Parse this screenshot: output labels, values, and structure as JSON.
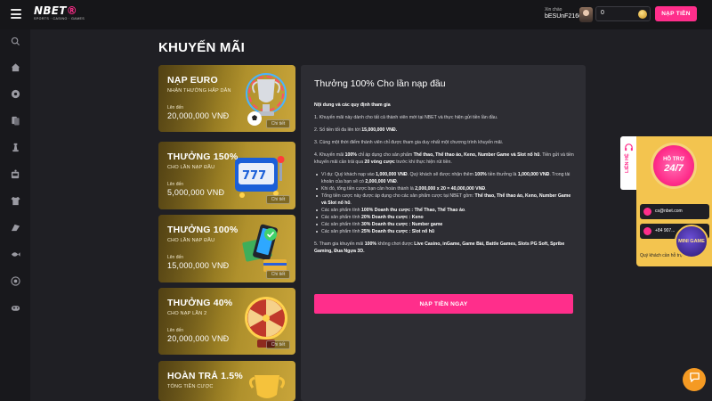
{
  "header": {
    "logo": "NBET",
    "logo_tagline": "SPORTS · CASINO · GAMES",
    "greeting": "Xin chào",
    "username": "bESUnF2166",
    "balance": "0",
    "deposit_label": "NẠP TIỀN",
    "colors": {
      "accent": "#ff2e8b",
      "bg": "#161619"
    }
  },
  "sidebar": {
    "icons": [
      "search-icon",
      "home-icon",
      "sports-ball-icon",
      "cards-icon",
      "chess-icon",
      "slot-machine-icon",
      "shirt-icon",
      "tent-icon",
      "fish-icon",
      "lottery-icon",
      "gamepad-icon"
    ]
  },
  "page": {
    "title": "KHUYẾN MÃI"
  },
  "promos": [
    {
      "title": "NẠP EURO",
      "subtitle": "NHẬN THƯỞNG HẤP DẪN",
      "label": "Lên đến",
      "amount": "20,000,000 VNĐ",
      "detail": "Chi tiết"
    },
    {
      "title": "THƯỞNG 150%",
      "subtitle": "CHO LẦN NẠP ĐẦU",
      "label": "Lên đến",
      "amount": "5,000,000 VNĐ",
      "detail": "Chi tiết"
    },
    {
      "title": "THƯỞNG 100%",
      "subtitle": "CHO LẦN NẠP ĐẦU",
      "label": "Lên đến",
      "amount": "15,000,000 VNĐ",
      "detail": "Chi tiết"
    },
    {
      "title": "THƯỞNG 40%",
      "subtitle": "CHO NẠP LẦN 2",
      "label": "Lên đến",
      "amount": "20,000,000 VNĐ",
      "detail": "Chi tiết"
    },
    {
      "title": "HOÀN TRẢ 1.5%",
      "subtitle": "TỔNG TIỀN CƯỢC"
    }
  ],
  "detail": {
    "title": "Thưởng 100% Cho lần nạp đầu",
    "heading": "Nội dung và các quy định tham gia",
    "p1": "1. Khuyến mãi này dành cho tất cả thành viên mới tại NBET và thực hiện gửi tiền lần đầu.",
    "p2_pre": "2. Số tiền tối đa lên tới ",
    "p2_bold": "15,000,000 VNĐ.",
    "p3": "3. Cùng một thời điểm thành viên chỉ được tham gia duy nhất một chương trình khuyến mãi.",
    "p4_a": "4. Khuyến mãi ",
    "p4_b": "100%",
    "p4_c": " chỉ áp dụng cho sản phẩm ",
    "p4_d": "Thể thao, Thể thao ảo, Keno, Number Game và Slot nổ hũ",
    "p4_e": ". Tiền gửi và tiền khuyến mãi cần trải qua ",
    "p4_f": "20 vòng cược",
    "p4_g": " trước khi thực hiện rút tiền.",
    "b1_a": "Ví dụ: Quý khách nạp vào ",
    "b1_b": "1,000,000 VNĐ",
    "b1_c": ". Quý khách sẽ được nhận thêm ",
    "b1_d": "100%",
    "b1_e": " tiền thưởng là ",
    "b1_f": "1,000,000 VNĐ",
    "b1_g": ". Trong tài khoản của bạn sẽ có ",
    "b1_h": "2,000,000 VNĐ",
    "b1_i": ".",
    "b2_a": "Khi đó, tổng tiền cược bạn cần hoàn thành là ",
    "b2_b": "2,000,000 x 20 = 40,000,000 VNĐ",
    "b2_c": ".",
    "b3_a": "Tổng tiền cược này được áp dụng cho các sản phẩm cược tại NBET gồm: ",
    "b3_b": "Thể thao, Thể thao ảo, Keno, Number Game và Slot nổ hũ",
    "b3_c": ".",
    "b4_a": "Các sản phẩm tính ",
    "b4_b": "100% Doanh thu cược : Thể Thao, Thể Thao ảo",
    "b4_c": ".",
    "b5_a": "Các sản phẩm tính ",
    "b5_b": "20% Doanh thu cược : Keno",
    "b6_a": "Các sản phẩm tính ",
    "b6_b": "30% Doanh thu cược : Number game",
    "b7_a": "Các sản phẩm tính ",
    "b7_b": "25% Doanh thu cược : Slot nổ hũ",
    "p5_a": "5. Tham gia khuyến mãi ",
    "p5_b": "100%",
    "p5_c": " không chơi được ",
    "p5_d": "Live Casino, inGame, Game Bài, Battle Games, Slots PG Soft, Spribe Gaming, Đua Ngựa 3D.",
    "join_label": "NẠP TIỀN NGAY"
  },
  "support": {
    "tab_label": "LIÊN HỆ",
    "badge_top": "HỖ TRỢ",
    "badge_main": "24/7",
    "email": "cs@nbet.com",
    "phone": "+84 907...",
    "question": "Quý khách cần hỗ trợ?",
    "game_label": "MINI GAME"
  }
}
